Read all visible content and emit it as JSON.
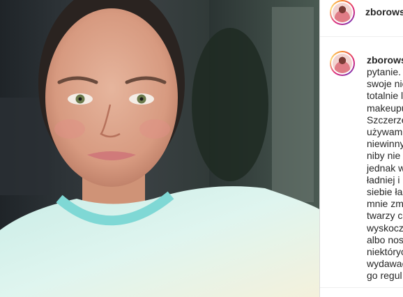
{
  "post": {
    "username": "zborowsk",
    "comment_username": "zborows",
    "caption_lines": [
      "pytanie.",
      "swoje nie",
      "totalnie l",
      "makeupu",
      "Szczerze",
      "używam",
      "niewinny",
      "niby nie",
      "jednak w",
      "ładniej i",
      "siebie łas",
      "mnie zm",
      "twarzy cz",
      "wyskoczy",
      "albo nos",
      "niektóryc",
      "wydawać",
      "go regul"
    ]
  },
  "icons": {
    "header_avatar": "profile-avatar",
    "comment_avatar": "profile-avatar"
  },
  "colors": {
    "story_ring_start": "#f58529",
    "story_ring_mid": "#dd2a7b",
    "story_ring_end": "#8134af",
    "text": "#262626",
    "border": "#dbdbdb"
  }
}
